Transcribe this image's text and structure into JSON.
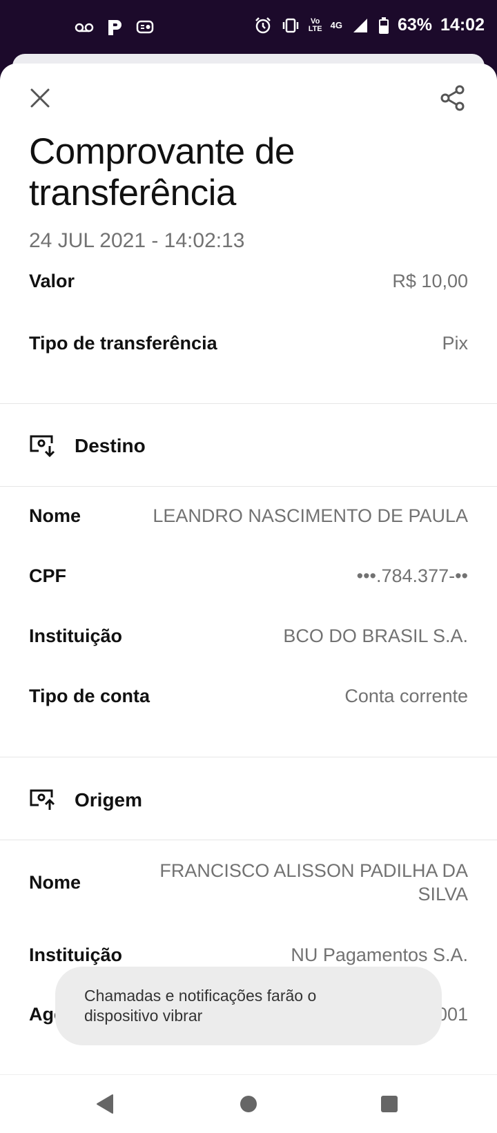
{
  "status_bar": {
    "battery": "63%",
    "time": "14:02",
    "network_volte": "Vo\nLTE",
    "network_type": "4G"
  },
  "receipt": {
    "title": "Comprovante de transferência",
    "datetime": "24 JUL 2021 - 14:02:13",
    "summary": [
      {
        "label": "Valor",
        "value": "R$ 10,00"
      },
      {
        "label": "Tipo de transferência",
        "value": "Pix"
      }
    ],
    "destination": {
      "heading": "Destino",
      "rows": [
        {
          "label": "Nome",
          "value": "LEANDRO NASCIMENTO DE PAULA"
        },
        {
          "label": "CPF",
          "value": "•••.784.377-••"
        },
        {
          "label": "Instituição",
          "value": "BCO DO BRASIL S.A."
        },
        {
          "label": "Tipo de conta",
          "value": "Conta corrente"
        }
      ]
    },
    "origin": {
      "heading": "Origem",
      "rows": [
        {
          "label": "Nome",
          "value": "FRANCISCO ALISSON PADILHA DA SILVA"
        },
        {
          "label": "Instituição",
          "value": "NU Pagamentos S.A."
        },
        {
          "label": "Agência",
          "value": "0001"
        }
      ]
    }
  },
  "toast": {
    "message": "Chamadas e notificações farão o dispositivo vibrar"
  },
  "icons": {
    "close": "close-icon",
    "share": "share-icon",
    "destination": "receive-money-icon",
    "origin": "send-money-icon",
    "nav_back": "back-triangle-icon",
    "nav_home": "home-circle-icon",
    "nav_recents": "recents-square-icon"
  },
  "colors": {
    "status_bar": "#1c0a2b",
    "text_primary": "#111111",
    "text_secondary": "#727272",
    "divider": "#e6e6e6",
    "toast_bg": "#ececec"
  }
}
